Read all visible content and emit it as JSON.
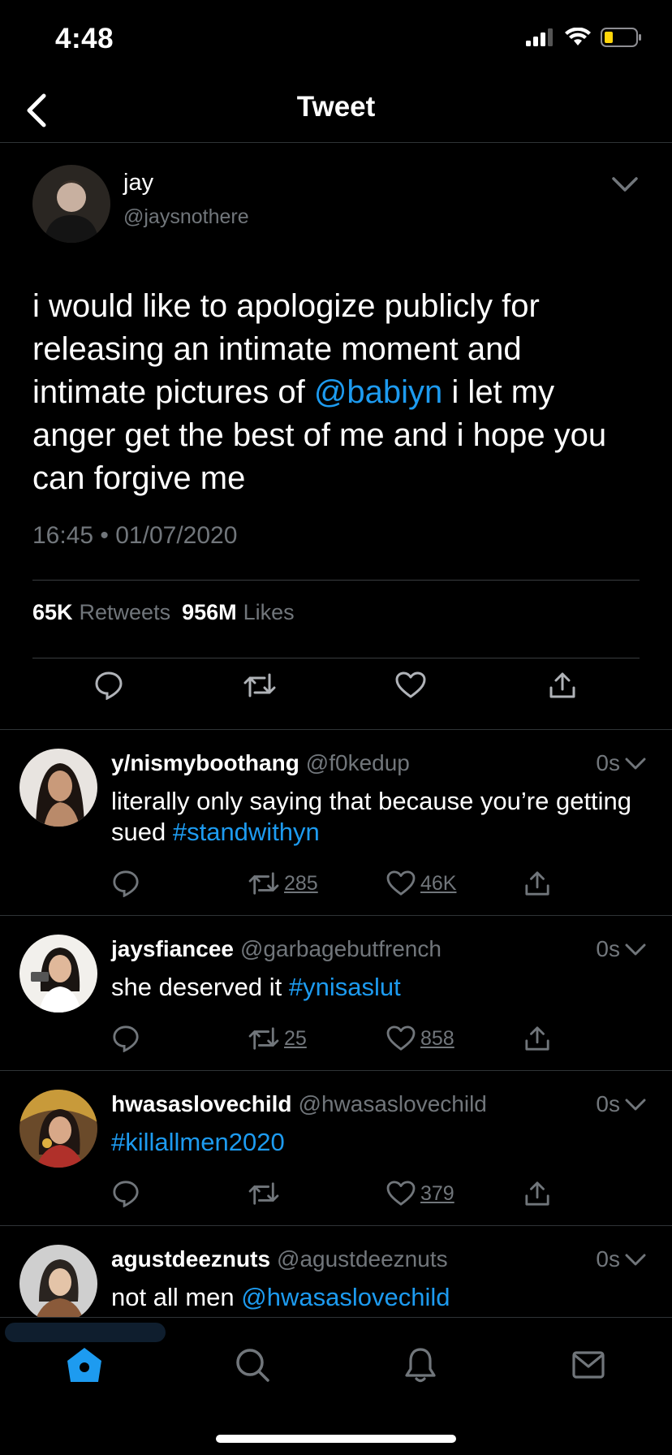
{
  "status_bar": {
    "time": "4:48"
  },
  "nav": {
    "title": "Tweet"
  },
  "main_tweet": {
    "name": "jay",
    "handle": "@jaysnothere",
    "text_parts": {
      "a": "i would like to apologize publicly for releasing an intimate moment and intimate pictures of ",
      "mention": "@babiyn",
      "b": " i let my anger get the best of me and i hope you can forgive me"
    },
    "timestamp": "16:45 • 01/07/2020",
    "retweets_count": "65K",
    "retweets_label": "Retweets",
    "likes_count": "956M",
    "likes_label": "Likes"
  },
  "replies": [
    {
      "name": "y/nismyboothang",
      "handle": "@f0kedup",
      "time": "0s",
      "text": "literally only saying that because you’re getting sued ",
      "tag": "#standwithyn",
      "retweets": "285",
      "likes": "46K"
    },
    {
      "name": "jaysfiancee",
      "handle": "@garbagebutfrench",
      "time": "0s",
      "text": "she deserved it ",
      "tag": "#ynisaslut",
      "retweets": "25",
      "likes": "858"
    },
    {
      "name": "hwasaslovechild",
      "handle": "@hwasaslovechild",
      "time": "0s",
      "text": "",
      "tag": "#killallmen2020",
      "retweets": "",
      "likes": "379"
    },
    {
      "name": "agustdeeznuts",
      "handle": "@agustdeeznuts",
      "time": "0s",
      "text": "not all men ",
      "tag": "@hwasaslovechild",
      "retweets": "",
      "likes": ""
    }
  ],
  "colors": {
    "accent": "#1d9bf0",
    "muted": "#71767b",
    "background": "#000000",
    "divider": "#2f3336"
  },
  "icons": {
    "status": [
      "signal-icon",
      "wifi-icon",
      "battery-icon"
    ],
    "tabs": [
      "home-icon",
      "search-icon",
      "bell-icon",
      "mail-icon"
    ],
    "actions": [
      "reply-icon",
      "retweet-icon",
      "like-icon",
      "share-icon"
    ]
  }
}
